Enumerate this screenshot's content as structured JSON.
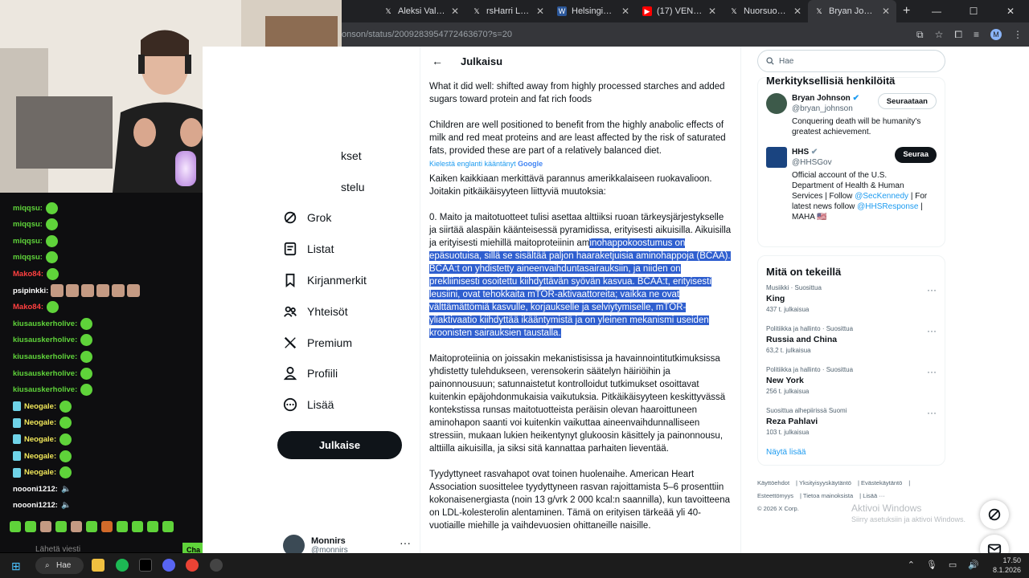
{
  "browser": {
    "tabs": [
      {
        "label": "Aleksi Valavuori",
        "icon": "x-logo-icon",
        "active": false
      },
      {
        "label": "rsHarri Lehtimäki",
        "icon": "x-logo-icon",
        "active": false
      },
      {
        "label": "Helsingin uusi k",
        "icon": "doc-icon",
        "active": false
      },
      {
        "label": "(17) VENEZUELA",
        "icon": "youtube-icon",
        "active": false
      },
      {
        "label": "Nuorsuomalaine",
        "icon": "x-logo-icon",
        "active": false
      },
      {
        "label": "Bryan Johnson X",
        "icon": "x-logo-icon",
        "active": true
      }
    ],
    "url": "onson/status/2009283954772463670?s=20",
    "profile_initial": "M"
  },
  "page_header": "Julkaisu",
  "nav": {
    "partial_1": "kset",
    "partial_2": "stelu",
    "items": [
      {
        "label": "Grok",
        "icon": "grok-icon"
      },
      {
        "label": "Listat",
        "icon": "list-icon"
      },
      {
        "label": "Kirjanmerkit",
        "icon": "bookmark-icon"
      },
      {
        "label": "Yhteisöt",
        "icon": "communities-icon"
      },
      {
        "label": "Premium",
        "icon": "x-logo-icon"
      },
      {
        "label": "Profiili",
        "icon": "person-icon"
      },
      {
        "label": "Lisää",
        "icon": "more-circle-icon"
      }
    ],
    "post_button": "Julkaise",
    "account_name": "Monnirs",
    "account_handle": "@monnirs"
  },
  "post": {
    "para1": "What it did well: shifted away from highly processed starches and added sugars toward protein and fat rich foods",
    "para2": "Children are well positioned to benefit from the highly anabolic effects of milk and red meat proteins and are least affected by the risk of saturated fats, provided these are part of a relatively balanced diet.",
    "translate_label": "Kielestä englanti kääntänyt",
    "translate_brand": "Google",
    "para3": "Kaiken kaikkiaan merkittävä parannus amerikkalaiseen ruokavalioon. Joitakin pitkäikäisyyteen liittyviä muutoksia:",
    "para4_pre": "0. Maito ja maitotuotteet tulisi asettaa alttiiksi ruoan tärkeysjärjestykselle ja siirtää alaspäin käänteisessä pyramidissa, erityisesti aikuisilla. Aikuisilla ja erityisesti miehillä maitoproteiinin am",
    "para4_hl": "inohappokoostumus on epäsuotuisa, sillä se sisältää paljon haaraketjuisia aminohappoja (BCAA). BCAA:t on yhdistetty aineenvaihduntasairauksiin, ja niiden on prekliinisesti osoitettu kiihdyttävän syövän kasvua. BCAA:t, erityisesti leusiini, ovat tehokkaita mTOR-aktivaattoreita; vaikka ne ovat välttämättömiä kasvulle, korjaukselle ja selviytymiselle, mTOR-yliaktivaatio kiihdyttää ikääntymistä ja on yleinen mekanismi useiden kroonisten sairauksien taustalla.",
    "para5": "Maitoproteiinia on joissakin mekanistisissa ja havainnointitutkimuksissa yhdistetty tulehdukseen, verensokerin säätelyn häiriöihin ja painonnousuun; satunnaistetut kontrolloidut tutkimukset osoittavat kuitenkin epäjohdonmukaisia vaikutuksia. Pitkäikäisyyteen keskittyvässä kontekstissa runsas maitotuotteista peräisin olevan haaroittuneen aminohapon saanti voi kuitenkin vaikuttaa aineenvaihdunnalliseen stressiin, mukaan lukien heikentynyt glukoosin käsittely ja painonnousu, alttiilla aikuisilla, ja siksi sitä kannattaa parhaiten lieventää.",
    "para6": "Tyydyttyneet rasvahapot ovat toinen huolenaihe. American Heart Association suosittelee tyydyttyneen rasvan rajoittamista 5–6 prosenttiin kokonaisenergiasta (noin 13 g/vrk 2 000 kcal:n saannilla), kun tavoitteena on LDL-kolesterolin alentaminen. Tämä on erityisen tärkeää yli 40-vuotiaille miehille ja vaihdevuosien ohittaneille naisille."
  },
  "right": {
    "search_placeholder": "Hae",
    "people_title": "Merkityksellisiä henkilöitä",
    "people": [
      {
        "name": "Bryan Johnson",
        "handle": "@bryan_johnson",
        "bio": "Conquering death will be humanity's greatest achievement.",
        "button": "Seuraataan",
        "avatar_color": "#3d5a4a"
      },
      {
        "name": "HHS",
        "handle": "@HHSGov",
        "bio_1": "Official account of the U.S. Department of Health & Human Services | Follow ",
        "link_1": "@SecKennedy",
        "bio_2": " | For latest news follow ",
        "link_2": "@HHSResponse",
        "bio_3": " | MAHA 🇺🇸",
        "button": "Seuraa",
        "avatar_color": "#1a4480"
      }
    ],
    "trends_title": "Mitä on tekeillä",
    "trends": [
      {
        "category": "Musiikki · Suosittua",
        "name": "King",
        "count": "437 t. julkaisua"
      },
      {
        "category": "Politiikka ja hallinto · Suosittua",
        "name": "Russia and China",
        "count": "63,2 t. julkaisua"
      },
      {
        "category": "Politiikka ja hallinto · Suosittua",
        "name": "New York",
        "count": "256 t. julkaisua"
      },
      {
        "category": "Suosittua alhepiirissä Suomi",
        "name": "Reza Pahlavi",
        "count": "103 t. julkaisua"
      }
    ],
    "show_more": "Näytä lisää",
    "footer": [
      "Käyttöehdot",
      "Yksityisyyskäytäntö",
      "Evästekäytäntö",
      "Esteettömyys",
      "Tietoa mainoksista",
      "Lisää ···",
      "© 2026 X Corp."
    ],
    "activate_1": "Aktivoi Windows",
    "activate_2": "Siirry asetuksiin ja aktivoi Windows."
  },
  "chat": {
    "lines": [
      {
        "user": "miqqsu:",
        "color": "#5fd33a",
        "kind": "emote"
      },
      {
        "user": "miqqsu:",
        "color": "#5fd33a",
        "kind": "emote"
      },
      {
        "user": "miqqsu:",
        "color": "#5fd33a",
        "kind": "emote"
      },
      {
        "user": "miqqsu:",
        "color": "#5fd33a",
        "kind": "emote"
      },
      {
        "user": "Mako84:",
        "color": "#ff4040",
        "kind": "emote"
      },
      {
        "user": "psipinkki:",
        "color": "#ffffff",
        "kind": "faces"
      },
      {
        "user": "Mako84:",
        "color": "#ff4040",
        "kind": "emote"
      },
      {
        "user": "kiusauskerholive:",
        "color": "#5fd33a",
        "kind": "emote"
      },
      {
        "user": "kiusauskerholive:",
        "color": "#5fd33a",
        "kind": "emote"
      },
      {
        "user": "kiusauskerholive:",
        "color": "#5fd33a",
        "kind": "emote"
      },
      {
        "user": "kiusauskerholive:",
        "color": "#5fd33a",
        "kind": "emote"
      },
      {
        "user": "kiusauskerholive:",
        "color": "#5fd33a",
        "kind": "emote"
      },
      {
        "user": "Neogale:",
        "color": "#f2e85a",
        "kind": "badge-emote"
      },
      {
        "user": "Neogale:",
        "color": "#f2e85a",
        "kind": "badge-emote"
      },
      {
        "user": "Neogale:",
        "color": "#f2e85a",
        "kind": "badge-emote"
      },
      {
        "user": "Neogale:",
        "color": "#f2e85a",
        "kind": "badge-emote"
      },
      {
        "user": "Neogale:",
        "color": "#f2e85a",
        "kind": "badge-emote"
      },
      {
        "user": "noooni1212:",
        "color": "#ffffff",
        "kind": "speaker"
      },
      {
        "user": "noooni1212:",
        "color": "#ffffff",
        "kind": "speaker"
      }
    ],
    "input_placeholder": "Lähetä viesti",
    "send_label": "Cha"
  },
  "taskbar": {
    "search": "Hae",
    "time": "17.50",
    "date": "8.1.2026"
  }
}
